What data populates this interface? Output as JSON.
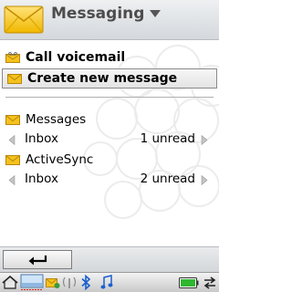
{
  "header": {
    "title": "Messaging",
    "icon": "envelope-icon"
  },
  "actions": [
    {
      "label": "Call voicemail",
      "icon": "voicemail-envelope-icon"
    },
    {
      "label": "Create new message",
      "icon": "envelope-icon"
    }
  ],
  "accounts": [
    {
      "name": "Messages",
      "folder": "Inbox",
      "status": "1 unread"
    },
    {
      "name": "ActiveSync",
      "folder": "Inbox",
      "status": "2 unread"
    }
  ],
  "softkey": {
    "back_icon": "back-arrow-icon"
  },
  "status_bar": {
    "icons": [
      "home-icon",
      "desktop-icon",
      "message-icon",
      "signal-icon",
      "bluetooth-icon",
      "music-icon",
      "battery-icon",
      "sync-icon"
    ]
  },
  "colors": {
    "envelope": "#f4c21c",
    "selection_border": "#8a8a8a",
    "header_text": "#4d4d4d"
  }
}
